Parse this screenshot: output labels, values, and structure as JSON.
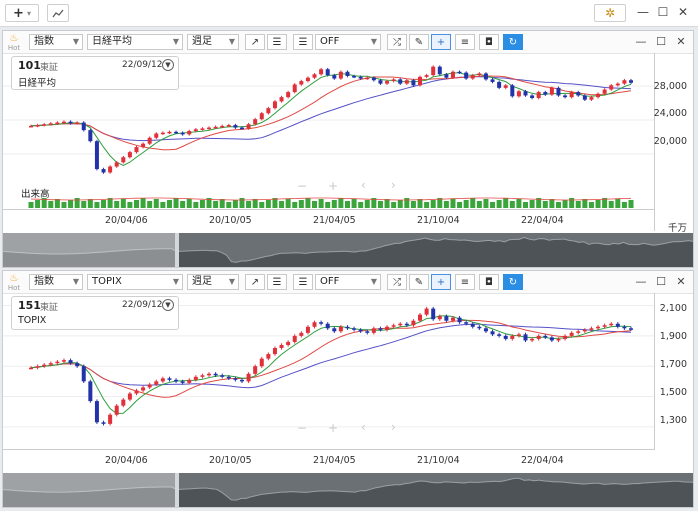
{
  "toolbar": {
    "add_label": "+",
    "add_caret": "▾",
    "chart_icon": "chart-line-icon"
  },
  "window": {
    "minimize": "—",
    "maximize": "☐",
    "close": "✕"
  },
  "colors": {
    "up": "#e0303a",
    "down": "#2233aa",
    "ma_short": "#2e9e3e",
    "ma_mid": "#e04a44",
    "ma_long": "#5550c8",
    "volume": "#3aa53a",
    "accent": "#2b8de3"
  },
  "panels": [
    {
      "hot_label": "Hot",
      "selects": {
        "type": "指数",
        "index": "日経平均",
        "period": "週足",
        "overlay": "OFF"
      },
      "info": {
        "code": "101",
        "exchange": "東証",
        "date": "22/09/12",
        "name": "日経平均"
      },
      "y_labels": [
        "28,000",
        "24,000",
        "20,000"
      ],
      "volume_label": "出来高",
      "volume_unit": "千万",
      "x_labels": [
        "20/04/06",
        "20/10/05",
        "21/04/05",
        "21/10/04",
        "22/04/04"
      ],
      "nav": {
        "zoom_out": "−",
        "zoom_in": "+",
        "prev": "‹",
        "next": "›"
      },
      "chart_data": {
        "type": "candlestick",
        "title": "日経平均",
        "ylim": [
          17500,
          30500
        ],
        "y_ticks": [
          20000,
          24000,
          28000
        ],
        "series": [
          {
            "name": "price",
            "values": [
              23300,
              23400,
              23500,
              23600,
              23700,
              23800,
              23600,
              23700,
              22800,
              21500,
              18200,
              17800,
              18500,
              19000,
              19600,
              20200,
              20800,
              21200,
              21900,
              22400,
              22500,
              22600,
              22500,
              22300,
              22700,
              22900,
              23000,
              23100,
              23200,
              23300,
              23400,
              23100,
              23000,
              23500,
              24100,
              24800,
              25400,
              26200,
              26700,
              27300,
              28200,
              28600,
              29000,
              29400,
              30000,
              29300,
              28900,
              29700,
              29200,
              29100,
              28900,
              29000,
              28700,
              28300,
              28600,
              28800,
              28300,
              28700,
              28100,
              29100,
              29300,
              30300,
              29400,
              29000,
              29700,
              29600,
              28900,
              29300,
              29500,
              28800,
              28500,
              27800,
              28100,
              26800,
              27400,
              26900,
              26600,
              27300,
              27000,
              27800,
              26900,
              26700,
              27300,
              26900,
              26400,
              26700,
              27100,
              27600,
              28100,
              28300,
              28700,
              28400
            ]
          }
        ]
      }
    },
    {
      "hot_label": "Hot",
      "selects": {
        "type": "指数",
        "index": "TOPIX",
        "period": "週足",
        "overlay": "OFF"
      },
      "info": {
        "code": "151",
        "exchange": "東証",
        "date": "22/09/12",
        "name": "TOPIX"
      },
      "y_labels": [
        "2,100",
        "1,900",
        "1,700",
        "1,500",
        "1,300"
      ],
      "x_labels": [
        "20/04/06",
        "20/10/05",
        "21/04/05",
        "21/10/04",
        "22/04/04"
      ],
      "nav": {
        "zoom_out": "−",
        "zoom_in": "+",
        "prev": "‹",
        "next": "›"
      },
      "chart_data": {
        "type": "candlestick",
        "title": "TOPIX",
        "ylim": [
          1220,
          2130
        ],
        "y_ticks": [
          1300,
          1500,
          1700,
          1900,
          2100
        ],
        "series": [
          {
            "name": "price",
            "values": [
              1690,
              1700,
              1710,
              1720,
              1730,
              1740,
              1720,
              1700,
              1600,
              1470,
              1330,
              1320,
              1380,
              1440,
              1480,
              1520,
              1540,
              1560,
              1580,
              1600,
              1620,
              1610,
              1600,
              1590,
              1610,
              1630,
              1640,
              1650,
              1640,
              1630,
              1620,
              1610,
              1600,
              1650,
              1700,
              1750,
              1780,
              1820,
              1840,
              1860,
              1900,
              1920,
              1960,
              1990,
              1980,
              1950,
              1930,
              1960,
              1950,
              1940,
              1930,
              1920,
              1950,
              1940,
              1960,
              1970,
              1980,
              1970,
              2000,
              2040,
              2080,
              2010,
              2030,
              2000,
              2020,
              1990,
              1980,
              1960,
              1950,
              1930,
              1910,
              1900,
              1880,
              1900,
              1910,
              1870,
              1880,
              1900,
              1890,
              1870,
              1880,
              1900,
              1920,
              1930,
              1940,
              1950,
              1960,
              1970,
              1980,
              1960,
              1950,
              1945
            ]
          }
        ]
      }
    }
  ]
}
